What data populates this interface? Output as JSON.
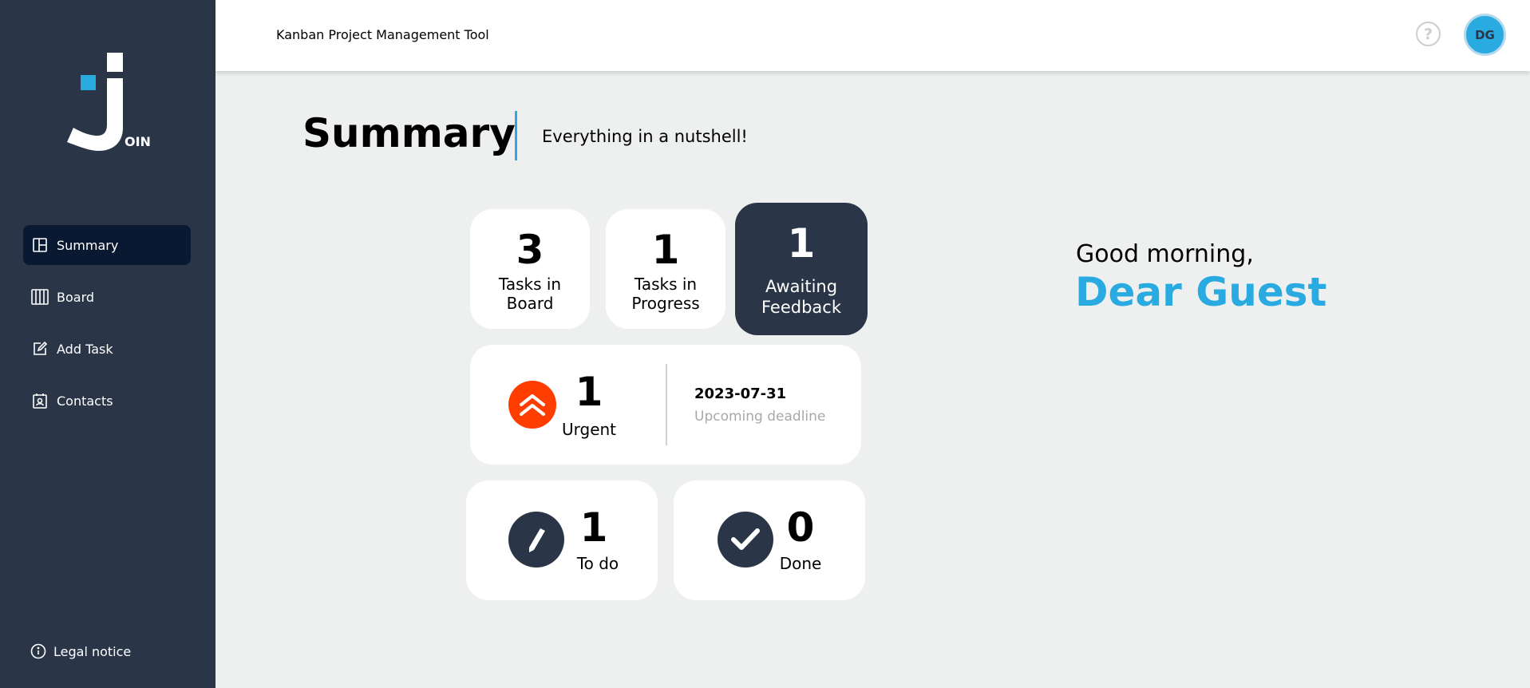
{
  "app": {
    "logo_text": "OIN",
    "title": "Kanban Project Management Tool"
  },
  "sidebar": {
    "items": [
      {
        "label": "Summary",
        "icon": "summary-icon",
        "active": true
      },
      {
        "label": "Board",
        "icon": "board-icon",
        "active": false
      },
      {
        "label": "Add Task",
        "icon": "add-task-icon",
        "active": false
      },
      {
        "label": "Contacts",
        "icon": "contacts-icon",
        "active": false
      }
    ],
    "legal": {
      "label": "Legal notice",
      "icon": "info-icon"
    }
  },
  "header": {
    "help_symbol": "?",
    "avatar_initials": "DG"
  },
  "page": {
    "title": "Summary",
    "subtitle": "Everything in a nutshell!"
  },
  "stats": {
    "board": {
      "count": "3",
      "line1": "Tasks in",
      "line2": "Board"
    },
    "progress": {
      "count": "1",
      "line1": "Tasks in",
      "line2": "Progress"
    },
    "feedback": {
      "count": "1",
      "line1": "Awaiting",
      "line2": "Feedback"
    },
    "urgent": {
      "count": "1",
      "label": "Urgent",
      "deadline_date": "2023-07-31",
      "deadline_label": "Upcoming deadline"
    },
    "todo": {
      "count": "1",
      "label": "To do"
    },
    "done": {
      "count": "0",
      "label": "Done"
    }
  },
  "greeting": {
    "text": "Good morning,",
    "name": "Dear Guest"
  },
  "colors": {
    "sidebar": "#2A3647",
    "active_nav": "#091931",
    "accent": "#29ABE2",
    "urgent": "#FF3D00",
    "background": "#EEF0EF"
  }
}
